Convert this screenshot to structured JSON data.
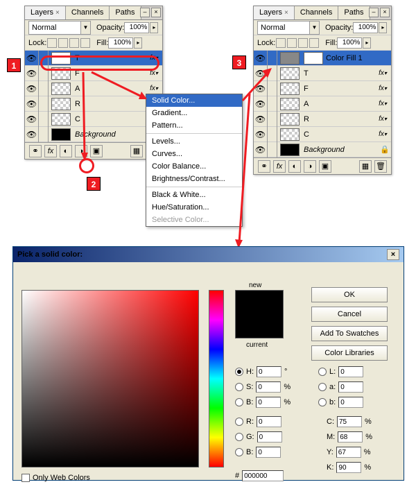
{
  "left_panel": {
    "tabs": [
      "Layers",
      "Channels",
      "Paths"
    ],
    "blend": "Normal",
    "opacity_label": "Opacity:",
    "opacity": "100%",
    "lock_label": "Lock:",
    "fill_label": "Fill:",
    "fill": "100%",
    "layers": [
      {
        "name": "T",
        "fx": true,
        "sel": true,
        "thumb": "white"
      },
      {
        "name": "F",
        "fx": true,
        "thumb": "checker"
      },
      {
        "name": "A",
        "fx": true,
        "thumb": "checker"
      },
      {
        "name": "R",
        "fx": true,
        "thumb": "checker"
      },
      {
        "name": "C",
        "fx": true,
        "thumb": "checker"
      },
      {
        "name": "Background",
        "fx": false,
        "thumb": "black",
        "lock": true,
        "italic": true
      }
    ]
  },
  "right_panel": {
    "tabs": [
      "Layers",
      "Channels",
      "Paths"
    ],
    "blend": "Normal",
    "opacity_label": "Opacity:",
    "opacity": "100%",
    "lock_label": "Lock:",
    "fill_label": "Fill:",
    "fill": "100%",
    "layers": [
      {
        "name": "Color Fill 1",
        "sel": true,
        "color_fill": true
      },
      {
        "name": "T",
        "fx": true,
        "thumb": "checker"
      },
      {
        "name": "F",
        "fx": true,
        "thumb": "checker"
      },
      {
        "name": "A",
        "fx": true,
        "thumb": "checker"
      },
      {
        "name": "R",
        "fx": true,
        "thumb": "checker"
      },
      {
        "name": "C",
        "fx": true,
        "thumb": "checker"
      },
      {
        "name": "Background",
        "fx": false,
        "thumb": "black",
        "lock": true,
        "italic": true
      }
    ]
  },
  "menu": {
    "items": [
      {
        "l": "Solid Color...",
        "sel": true
      },
      {
        "l": "Gradient..."
      },
      {
        "l": "Pattern..."
      },
      {
        "sep": true
      },
      {
        "l": "Levels..."
      },
      {
        "l": "Curves..."
      },
      {
        "l": "Color Balance..."
      },
      {
        "l": "Brightness/Contrast..."
      },
      {
        "sep": true
      },
      {
        "l": "Black & White..."
      },
      {
        "l": "Hue/Saturation..."
      },
      {
        "l": "Selective Color...",
        "dis": true
      }
    ]
  },
  "badges": {
    "b1": "1",
    "b2": "2",
    "b3": "3"
  },
  "dialog": {
    "title": "Pick a solid color:",
    "new": "new",
    "current": "current",
    "ok": "OK",
    "cancel": "Cancel",
    "add": "Add To Swatches",
    "lib": "Color Libraries",
    "H": "0",
    "S": "0",
    "B": "0",
    "R": "0",
    "G": "0",
    "Bb": "0",
    "L": "0",
    "a": "0",
    "b": "0",
    "C": "75",
    "M": "68",
    "Y": "67",
    "K": "90",
    "hex": "000000",
    "owc": "Only Web Colors",
    "lbl": {
      "H": "H:",
      "S": "S:",
      "B": "B:",
      "R": "R:",
      "G": "G:",
      "Bb": "B:",
      "L": "L:",
      "a": "a:",
      "b": "b:",
      "C": "C:",
      "M": "M:",
      "Y": "Y:",
      "K": "K:",
      "deg": "°",
      "pct": "%",
      "hash": "#"
    }
  }
}
